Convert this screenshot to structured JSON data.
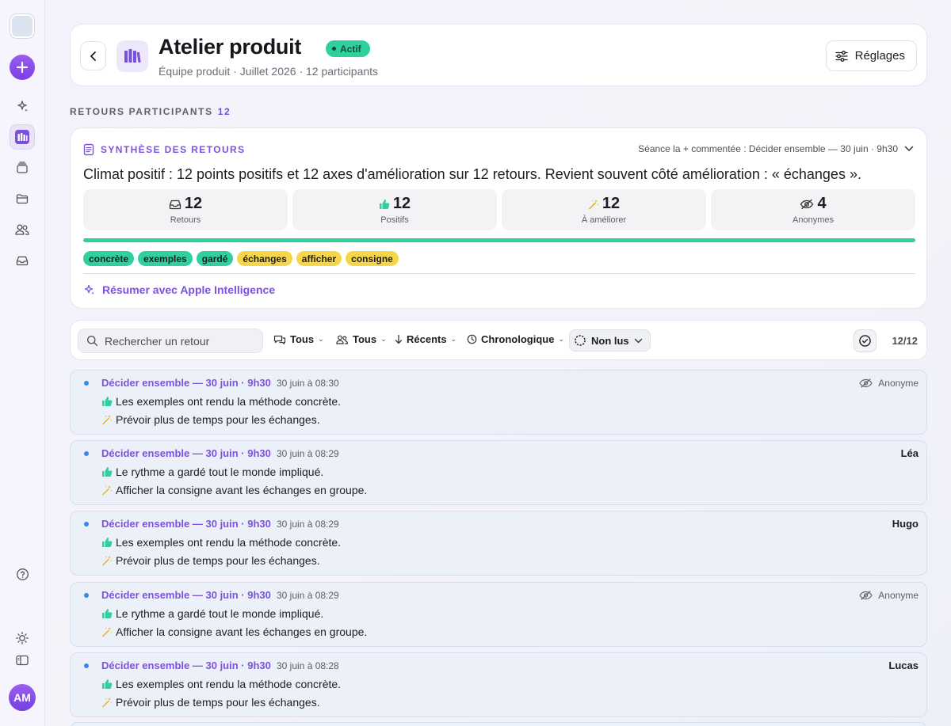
{
  "sidebar": {
    "avatar_initials": "AM"
  },
  "header": {
    "title": "Atelier produit",
    "status": "Actif",
    "subtitle": "Équipe produit · Juillet 2026 · 12 participants",
    "settings_label": "Réglages"
  },
  "section": {
    "label": "RETOURS PARTICIPANTS",
    "count": "12"
  },
  "summary": {
    "heading": "SYNTHÈSE DES RETOURS",
    "session_note": "Séance la + commentée : Décider ensemble — 30 juin · 9h30",
    "text": "Climat positif : 12 points positifs et 12 axes d'amélioration sur 12 retours. Revient souvent côté amélioration : « échanges ».",
    "stats": [
      {
        "value": "12",
        "label": "Retours",
        "icon": "inbox-icon"
      },
      {
        "value": "12",
        "label": "Positifs",
        "icon": "thumbs-up-icon"
      },
      {
        "value": "12",
        "label": "À améliorer",
        "icon": "magic-wand-icon"
      },
      {
        "value": "4",
        "label": "Anonymes",
        "icon": "eye-slash-icon"
      }
    ],
    "progress": 1.0,
    "tags": [
      {
        "text": "concrète",
        "kind": "positive"
      },
      {
        "text": "exemples",
        "kind": "positive"
      },
      {
        "text": "gardé",
        "kind": "positive"
      },
      {
        "text": "échanges",
        "kind": "improve"
      },
      {
        "text": "afficher",
        "kind": "improve"
      },
      {
        "text": "consigne",
        "kind": "improve"
      }
    ],
    "ai_action": "Résumer avec Apple Intelligence"
  },
  "toolbar": {
    "search_placeholder": "Rechercher un retour",
    "filter_type": "Tous",
    "filter_people": "Tous",
    "sort": "Récents",
    "view": "Chronologique",
    "unread": "Non lus",
    "count": "12/12"
  },
  "feedback": [
    {
      "session": "Décider ensemble — 30 juin · 9h30",
      "time": "30 juin à 08:30",
      "author": "Anonyme",
      "anonymous": true,
      "positive": "Les exemples ont rendu la méthode concrète.",
      "improve": "Prévoir plus de temps pour les échanges."
    },
    {
      "session": "Décider ensemble — 30 juin · 9h30",
      "time": "30 juin à 08:29",
      "author": "Léa",
      "anonymous": false,
      "positive": "Le rythme a gardé tout le monde impliqué.",
      "improve": "Afficher la consigne avant les échanges en groupe."
    },
    {
      "session": "Décider ensemble — 30 juin · 9h30",
      "time": "30 juin à 08:29",
      "author": "Hugo",
      "anonymous": false,
      "positive": "Les exemples ont rendu la méthode concrète.",
      "improve": "Prévoir plus de temps pour les échanges."
    },
    {
      "session": "Décider ensemble — 30 juin · 9h30",
      "time": "30 juin à 08:29",
      "author": "Anonyme",
      "anonymous": true,
      "positive": "Le rythme a gardé tout le monde impliqué.",
      "improve": "Afficher la consigne avant les échanges en groupe."
    },
    {
      "session": "Décider ensemble — 30 juin · 9h30",
      "time": "30 juin à 08:28",
      "author": "Lucas",
      "anonymous": false,
      "positive": "Les exemples ont rendu la méthode concrète.",
      "improve": "Prévoir plus de temps pour les échanges."
    }
  ],
  "colors": {
    "accent": "#7c52de",
    "positive": "#2fcf9e",
    "improve": "#f5d64b",
    "unread_dot": "#3d84ee"
  }
}
